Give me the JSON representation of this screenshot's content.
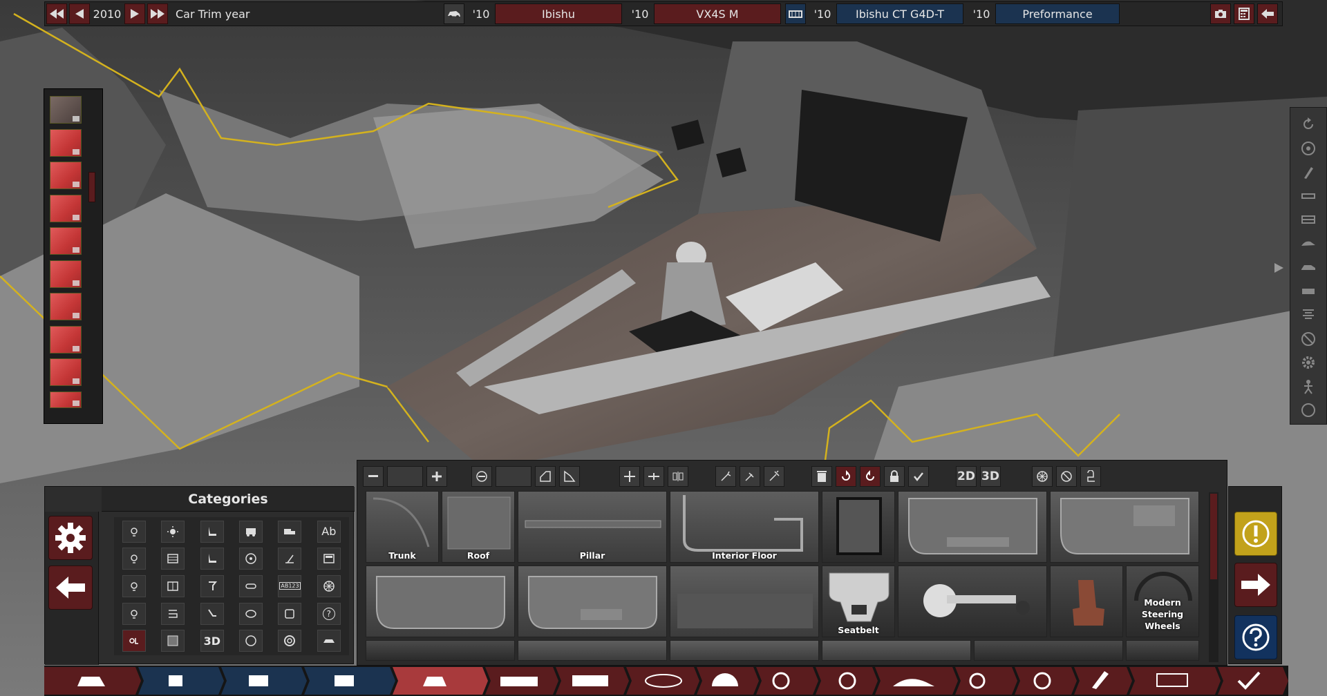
{
  "topbar": {
    "year": "2010",
    "trim_label": "Car Trim year",
    "model_year": "'10",
    "model_name": "Ibishu",
    "trim_year": "'10",
    "trim_name": "VX4S M",
    "engine_year": "'10",
    "engine_name": "Ibishu CT G4D-T",
    "engine_trim_year": "'10",
    "engine_trim_name": "Preformance"
  },
  "categories": {
    "title": "Categories",
    "text_icons": {
      "ab": "Ab",
      "ab123": "AB123",
      "three_d": "3D",
      "help": "?"
    }
  },
  "parts_toolbar": {
    "two_d": "2D",
    "three_d": "3D"
  },
  "parts": [
    {
      "label": "Trunk"
    },
    {
      "label": "Roof"
    },
    {
      "label": "Pillar"
    },
    {
      "label": "Interior Floor"
    },
    {
      "label": ""
    },
    {
      "label": ""
    },
    {
      "label": ""
    },
    {
      "label": ""
    },
    {
      "label": ""
    },
    {
      "label": ""
    },
    {
      "label": "Seatbelt"
    },
    {
      "label": ""
    },
    {
      "label": ""
    },
    {
      "label": "Modern Steering Wheels"
    }
  ],
  "colors": {
    "accent_red": "#5a1c1e",
    "accent_blue": "#1b3350",
    "warning_yellow": "#c2a21b",
    "help_blue": "#12325e",
    "highlight_outline": "#d4b21e"
  }
}
